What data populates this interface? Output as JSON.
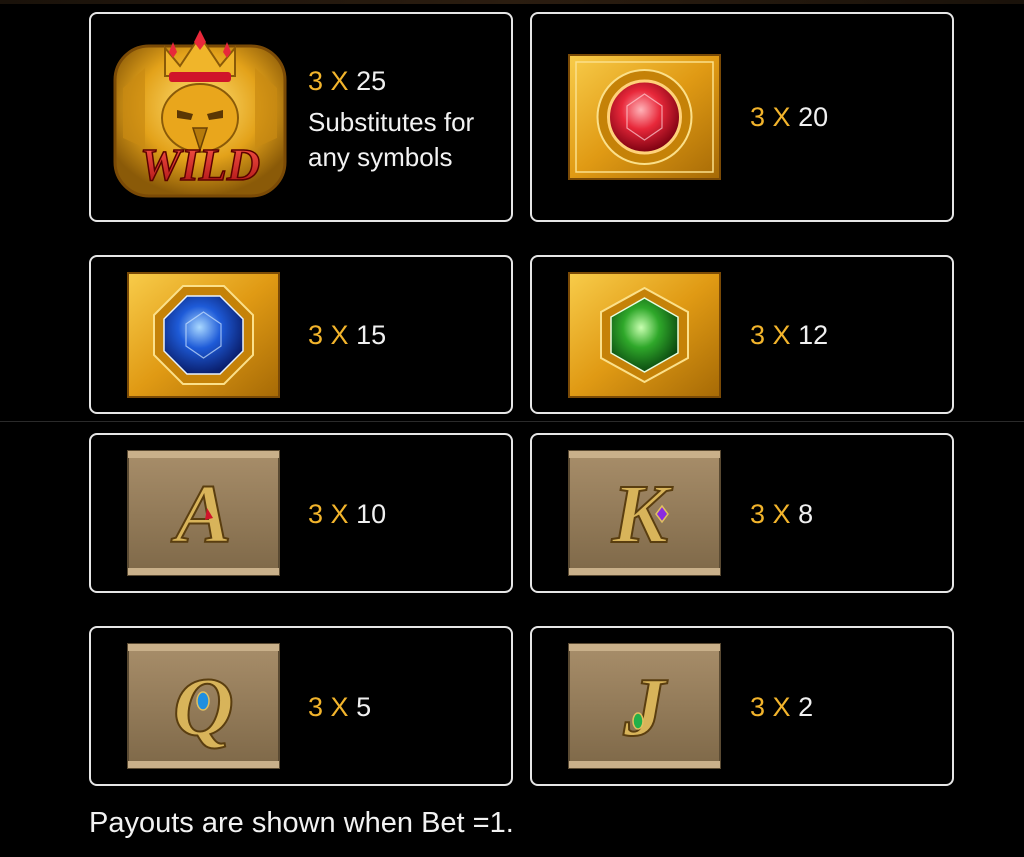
{
  "paytable": {
    "wild": {
      "symbol": "WILD",
      "count": "3",
      "x": "X",
      "payout": "25",
      "line1": "Substitutes for",
      "line2": "any symbols"
    },
    "red_gem": {
      "count": "3",
      "x": "X",
      "payout": "20"
    },
    "blue_gem": {
      "count": "3",
      "x": "X",
      "payout": "15"
    },
    "green_gem": {
      "count": "3",
      "x": "X",
      "payout": "12"
    },
    "a": {
      "letter": "A",
      "count": "3",
      "x": "X",
      "payout": "10"
    },
    "k": {
      "letter": "K",
      "count": "3",
      "x": "X",
      "payout": "8"
    },
    "q": {
      "letter": "Q",
      "count": "3",
      "x": "X",
      "payout": "5"
    },
    "j": {
      "letter": "J",
      "count": "3",
      "x": "X",
      "payout": "2"
    }
  },
  "footer": "Payouts are shown when Bet =1.",
  "colors": {
    "accent": "#f2b42c",
    "border": "#e6e6e6",
    "background": "#000000"
  }
}
